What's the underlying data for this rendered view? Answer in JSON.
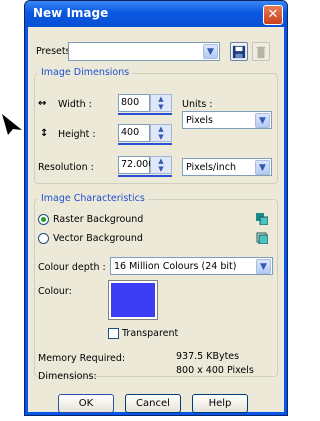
{
  "window": {
    "title": "New Image"
  },
  "presets": {
    "label": "Presets:",
    "value": ""
  },
  "dimensions": {
    "legend": "Image Dimensions",
    "width_label": "Width :",
    "width_value": "800",
    "height_label": "Height :",
    "height_value": "400",
    "units_label": "Units :",
    "units_value": "Pixels",
    "resolution_label": "Resolution :",
    "resolution_value": "72.000",
    "resolution_units": "Pixels/inch"
  },
  "characteristics": {
    "legend": "Image Characteristics",
    "raster": "Raster Background",
    "vector": "Vector Background",
    "selected": "raster",
    "colour_depth_label": "Colour depth :",
    "colour_depth_value": "16 Million Colours (24 bit)",
    "colour_label": "Colour:",
    "colour_swatch": "#3d3df5",
    "transparent_label": "Transparent",
    "transparent_checked": false
  },
  "info": {
    "memory_label": "Memory Required:",
    "memory_value": "937.5 KBytes",
    "dimensions_label": "Dimensions:",
    "dimensions_value": "800 x 400 Pixels"
  },
  "buttons": {
    "ok": "OK",
    "cancel": "Cancel",
    "help": "Help"
  },
  "colors": {
    "accent": "#1f4fcd",
    "title_bar": "#0a57df",
    "dialog_bg": "#ece9d8"
  }
}
